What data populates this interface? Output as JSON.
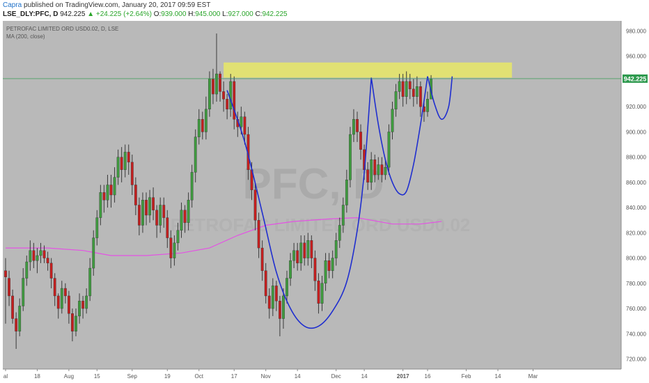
{
  "header": {
    "author": "Capra",
    "published_text": "published on TradingView.com, January 20, 2017 09:59 EST",
    "symbol": "LSE_DLY:PFC, D",
    "last": "942.225",
    "change": "+24.225 (+2.64%)",
    "open_label": "O:",
    "open": "939.000",
    "high_label": "H:",
    "high": "945.000",
    "low_label": "L:",
    "low": "927.000",
    "close_label": "C:",
    "close": "942.225"
  },
  "chart_data": {
    "type": "candlestick",
    "legend_text": [
      "PETROFAC LIMITED ORD USD0.02, D, LSE",
      "MA (200, close)"
    ],
    "watermark": "PFC, D",
    "watermark_sub": "PETROFAC LIMITED ORD USD0.02",
    "ylim": [
      712,
      988
    ],
    "y_ticks": [
      "980.000",
      "960.000",
      "940.000",
      "920.000",
      "900.000",
      "880.000",
      "860.000",
      "840.000",
      "820.000",
      "800.000",
      "780.000",
      "760.000",
      "740.000",
      "720.000"
    ],
    "y_tick_values": [
      980,
      960,
      940,
      920,
      900,
      880,
      860,
      840,
      820,
      800,
      780,
      760,
      740,
      720
    ],
    "x_ticks": [
      {
        "label": "al",
        "i": 0
      },
      {
        "label": "18",
        "i": 9
      },
      {
        "label": "Aug",
        "i": 18
      },
      {
        "label": "15",
        "i": 26
      },
      {
        "label": "Sep",
        "i": 36
      },
      {
        "label": "19",
        "i": 46
      },
      {
        "label": "Oct",
        "i": 55
      },
      {
        "label": "17",
        "i": 65
      },
      {
        "label": "Nov",
        "i": 74
      },
      {
        "label": "14",
        "i": 83
      },
      {
        "label": "Dec",
        "i": 94
      },
      {
        "label": "14",
        "i": 102
      },
      {
        "label": "2017",
        "i": 113
      },
      {
        "label": "16",
        "i": 120
      },
      {
        "label": "Feb",
        "i": 131
      },
      {
        "label": "14",
        "i": 140
      },
      {
        "label": "Mar",
        "i": 150
      }
    ],
    "last_price": 942.225,
    "last_price_label": "942.225",
    "colors": {
      "background": "#b9b9b9",
      "up": "#3f9b3f",
      "down": "#c41f1f",
      "ma": "#e452e4",
      "pattern": "#1f2ecf",
      "zone": "#e5e56b",
      "price_line": "#2f9a4f",
      "price_label_bg": "#2f9a4f"
    },
    "resistance_zone": {
      "from_i": 62,
      "to_i": 144,
      "low": 943,
      "high": 955
    },
    "ma_200": [
      {
        "i": 0,
        "v": 808
      },
      {
        "i": 12,
        "v": 808
      },
      {
        "i": 22,
        "v": 806
      },
      {
        "i": 30,
        "v": 802
      },
      {
        "i": 40,
        "v": 802
      },
      {
        "i": 50,
        "v": 804
      },
      {
        "i": 58,
        "v": 808
      },
      {
        "i": 66,
        "v": 818
      },
      {
        "i": 74,
        "v": 826
      },
      {
        "i": 82,
        "v": 829
      },
      {
        "i": 92,
        "v": 831
      },
      {
        "i": 100,
        "v": 832
      },
      {
        "i": 110,
        "v": 827
      },
      {
        "i": 118,
        "v": 827
      },
      {
        "i": 124,
        "v": 829
      }
    ],
    "pattern_curves": [
      {
        "name": "",
        "points": [
          [
            63,
            933
          ],
          [
            68,
            892
          ],
          [
            73,
            836
          ],
          [
            77,
            789
          ],
          [
            81,
            760
          ],
          [
            85,
            746
          ],
          [
            89,
            746
          ],
          [
            93,
            758
          ],
          [
            97,
            781
          ],
          [
            100,
            822
          ],
          [
            102,
            868
          ],
          [
            104,
            943
          ]
        ]
      },
      {
        "name": "",
        "points": [
          [
            104,
            943
          ],
          [
            106,
            906
          ],
          [
            108,
            878
          ],
          [
            110,
            860
          ],
          [
            112,
            851
          ],
          [
            114,
            853
          ],
          [
            116,
            874
          ],
          [
            118,
            906
          ],
          [
            120,
            944
          ]
        ]
      },
      {
        "name": "",
        "points": [
          [
            120,
            944
          ],
          [
            122,
            922
          ],
          [
            124,
            910
          ],
          [
            126,
            920
          ],
          [
            127,
            944
          ]
        ]
      }
    ],
    "candles": [
      [
        790,
        785,
        800,
        748
      ],
      [
        784,
        770,
        790,
        762
      ],
      [
        770,
        752,
        775,
        748
      ],
      [
        752,
        742,
        757,
        728
      ],
      [
        742,
        762,
        768,
        738
      ],
      [
        762,
        784,
        792,
        758
      ],
      [
        784,
        797,
        802,
        778
      ],
      [
        797,
        806,
        814,
        790
      ],
      [
        806,
        798,
        812,
        792
      ],
      [
        798,
        802,
        808,
        788
      ],
      [
        802,
        806,
        812,
        796
      ],
      [
        806,
        800,
        810,
        796
      ],
      [
        800,
        796,
        805,
        790
      ],
      [
        796,
        784,
        800,
        776
      ],
      [
        784,
        770,
        788,
        762
      ],
      [
        770,
        760,
        772,
        752
      ],
      [
        760,
        776,
        782,
        756
      ],
      [
        776,
        770,
        780,
        764
      ],
      [
        770,
        756,
        774,
        748
      ],
      [
        756,
        742,
        760,
        734
      ],
      [
        742,
        754,
        760,
        738
      ],
      [
        754,
        766,
        772,
        748
      ],
      [
        766,
        760,
        770,
        752
      ],
      [
        760,
        770,
        776,
        756
      ],
      [
        770,
        792,
        800,
        766
      ],
      [
        792,
        816,
        822,
        786
      ],
      [
        816,
        832,
        838,
        810
      ],
      [
        832,
        852,
        858,
        826
      ],
      [
        852,
        846,
        858,
        836
      ],
      [
        846,
        858,
        866,
        840
      ],
      [
        858,
        850,
        866,
        840
      ],
      [
        850,
        864,
        872,
        844
      ],
      [
        864,
        880,
        886,
        858
      ],
      [
        880,
        870,
        888,
        860
      ],
      [
        870,
        884,
        890,
        864
      ],
      [
        884,
        876,
        890,
        866
      ],
      [
        876,
        858,
        882,
        850
      ],
      [
        858,
        842,
        864,
        834
      ],
      [
        842,
        826,
        848,
        818
      ],
      [
        826,
        846,
        852,
        820
      ],
      [
        846,
        834,
        852,
        826
      ],
      [
        834,
        848,
        854,
        828
      ],
      [
        848,
        838,
        856,
        830
      ],
      [
        838,
        826,
        842,
        816
      ],
      [
        826,
        842,
        848,
        820
      ],
      [
        842,
        832,
        848,
        824
      ],
      [
        832,
        816,
        838,
        808
      ],
      [
        816,
        800,
        822,
        792
      ],
      [
        800,
        812,
        818,
        794
      ],
      [
        812,
        822,
        828,
        806
      ],
      [
        822,
        838,
        844,
        816
      ],
      [
        838,
        828,
        842,
        820
      ],
      [
        828,
        846,
        852,
        822
      ],
      [
        846,
        868,
        874,
        840
      ],
      [
        868,
        896,
        902,
        860
      ],
      [
        896,
        910,
        918,
        890
      ],
      [
        910,
        900,
        916,
        894
      ],
      [
        900,
        918,
        928,
        894
      ],
      [
        918,
        942,
        948,
        912
      ],
      [
        942,
        930,
        950,
        922
      ],
      [
        930,
        946,
        978,
        924
      ],
      [
        946,
        932,
        948,
        924
      ],
      [
        932,
        926,
        940,
        916
      ],
      [
        926,
        918,
        930,
        910
      ],
      [
        918,
        940,
        946,
        912
      ],
      [
        940,
        910,
        944,
        902
      ],
      [
        910,
        904,
        916,
        896
      ],
      [
        904,
        912,
        920,
        898
      ],
      [
        912,
        898,
        916,
        890
      ],
      [
        898,
        870,
        904,
        862
      ],
      [
        870,
        854,
        876,
        846
      ],
      [
        854,
        830,
        860,
        822
      ],
      [
        830,
        808,
        836,
        800
      ],
      [
        808,
        790,
        814,
        782
      ],
      [
        790,
        770,
        796,
        764
      ],
      [
        770,
        760,
        776,
        752
      ],
      [
        760,
        778,
        784,
        754
      ],
      [
        778,
        766,
        782,
        758
      ],
      [
        766,
        752,
        770,
        738
      ],
      [
        752,
        770,
        776,
        744
      ],
      [
        770,
        784,
        790,
        764
      ],
      [
        784,
        798,
        804,
        778
      ],
      [
        798,
        806,
        812,
        792
      ],
      [
        806,
        796,
        812,
        790
      ],
      [
        796,
        812,
        818,
        790
      ],
      [
        812,
        800,
        818,
        794
      ],
      [
        800,
        814,
        820,
        794
      ],
      [
        814,
        800,
        818,
        792
      ],
      [
        800,
        782,
        806,
        774
      ],
      [
        782,
        764,
        788,
        756
      ],
      [
        764,
        780,
        786,
        758
      ],
      [
        780,
        798,
        804,
        774
      ],
      [
        798,
        790,
        804,
        784
      ],
      [
        790,
        800,
        806,
        784
      ],
      [
        800,
        814,
        820,
        794
      ],
      [
        814,
        826,
        832,
        808
      ],
      [
        826,
        842,
        848,
        820
      ],
      [
        842,
        862,
        870,
        836
      ],
      [
        862,
        898,
        904,
        856
      ],
      [
        898,
        910,
        918,
        892
      ],
      [
        910,
        900,
        916,
        892
      ],
      [
        900,
        886,
        906,
        878
      ],
      [
        886,
        870,
        890,
        862
      ],
      [
        870,
        860,
        876,
        854
      ],
      [
        860,
        878,
        884,
        854
      ],
      [
        878,
        866,
        882,
        860
      ],
      [
        866,
        874,
        880,
        862
      ],
      [
        874,
        866,
        880,
        860
      ],
      [
        866,
        872,
        878,
        862
      ],
      [
        872,
        900,
        906,
        866
      ],
      [
        900,
        918,
        924,
        894
      ],
      [
        918,
        932,
        938,
        912
      ],
      [
        932,
        940,
        946,
        926
      ],
      [
        940,
        928,
        946,
        920
      ],
      [
        928,
        940,
        948,
        922
      ],
      [
        940,
        934,
        946,
        926
      ],
      [
        934,
        928,
        942,
        920
      ],
      [
        928,
        936,
        944,
        922
      ],
      [
        936,
        920,
        940,
        912
      ],
      [
        920,
        916,
        924,
        908
      ],
      [
        916,
        926,
        932,
        912
      ],
      [
        926,
        942,
        945,
        927
      ]
    ]
  }
}
